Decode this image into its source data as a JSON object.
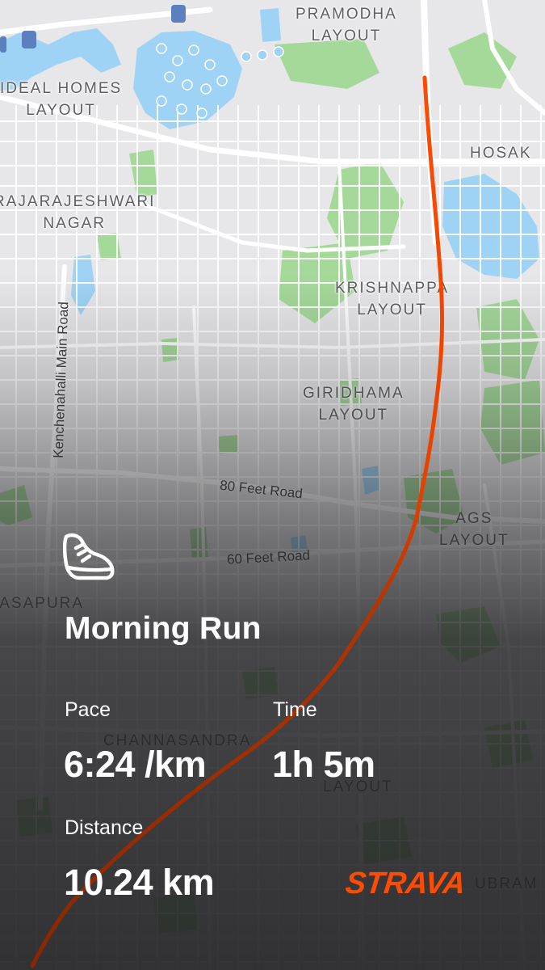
{
  "map": {
    "labels": {
      "pramodha": "PRAMODHA\nLAYOUT",
      "ideal_homes": "IDEAL HOMES\nLAYOUT",
      "hosak": "HOSAK",
      "rajarajeshwari": "RAJARAJESHWARI\nNAGAR",
      "krishnappa": "KRISHNAPPA\nLAYOUT",
      "giridhama": "GIRIDHAMA\nLAYOUT",
      "ags": "AGS\nLAYOUT",
      "vasapura": "VASAPURA",
      "channasandra": "CHANNASANDRA",
      "layout": "LAYOUT",
      "ubram": "UBRAM"
    },
    "roads": {
      "kenchenahalli": "Kenchenahalli Main Road",
      "eighty_feet": "80 Feet Road",
      "sixty_feet": "60 Feet Road"
    },
    "colors": {
      "land": "#e7e7ea",
      "road": "#ffffff",
      "park": "#a5d99a",
      "water": "#9fd3f5"
    }
  },
  "route": {
    "color_start": "#fc4c02",
    "color_end": "#8a2600"
  },
  "activity": {
    "icon": "running-shoe-icon",
    "title": "Morning Run",
    "stats": {
      "pace_label": "Pace",
      "pace_value": "6:24 /km",
      "time_label": "Time",
      "time_value": "1h 5m",
      "distance_label": "Distance",
      "distance_value": "10.24 km"
    }
  },
  "brand": {
    "name": "STRAVA",
    "color": "#fc4c02"
  }
}
